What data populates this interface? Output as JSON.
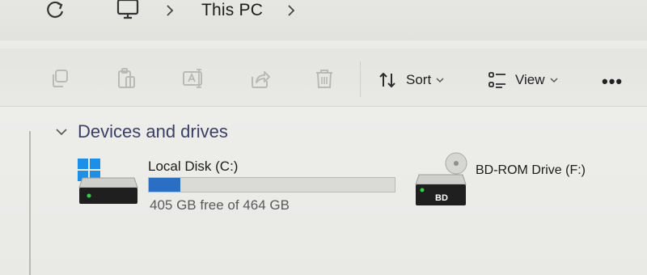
{
  "address_bar": {
    "refresh_icon": "refresh-icon",
    "location_icon": "this-pc-icon",
    "crumbs": [
      "This PC"
    ]
  },
  "command_bar": {
    "icons": [
      "copy-icon",
      "paste-icon",
      "rename-icon",
      "share-icon",
      "delete-icon"
    ],
    "sort_label": "Sort",
    "view_label": "View",
    "more_label": "•••"
  },
  "main": {
    "group_title": "Devices and drives",
    "drives": [
      {
        "name": "Local Disk (C:)",
        "free_text": "405 GB free of 464 GB",
        "used_fraction": 0.127,
        "icon": "windows-drive-icon"
      },
      {
        "name": "BD-ROM Drive (F:)",
        "badge": "BD",
        "icon": "bd-rom-drive-icon"
      }
    ]
  },
  "colors": {
    "accent": "#2a6fc4",
    "group_title": "#3a3f63",
    "background": "#ebebe8"
  }
}
